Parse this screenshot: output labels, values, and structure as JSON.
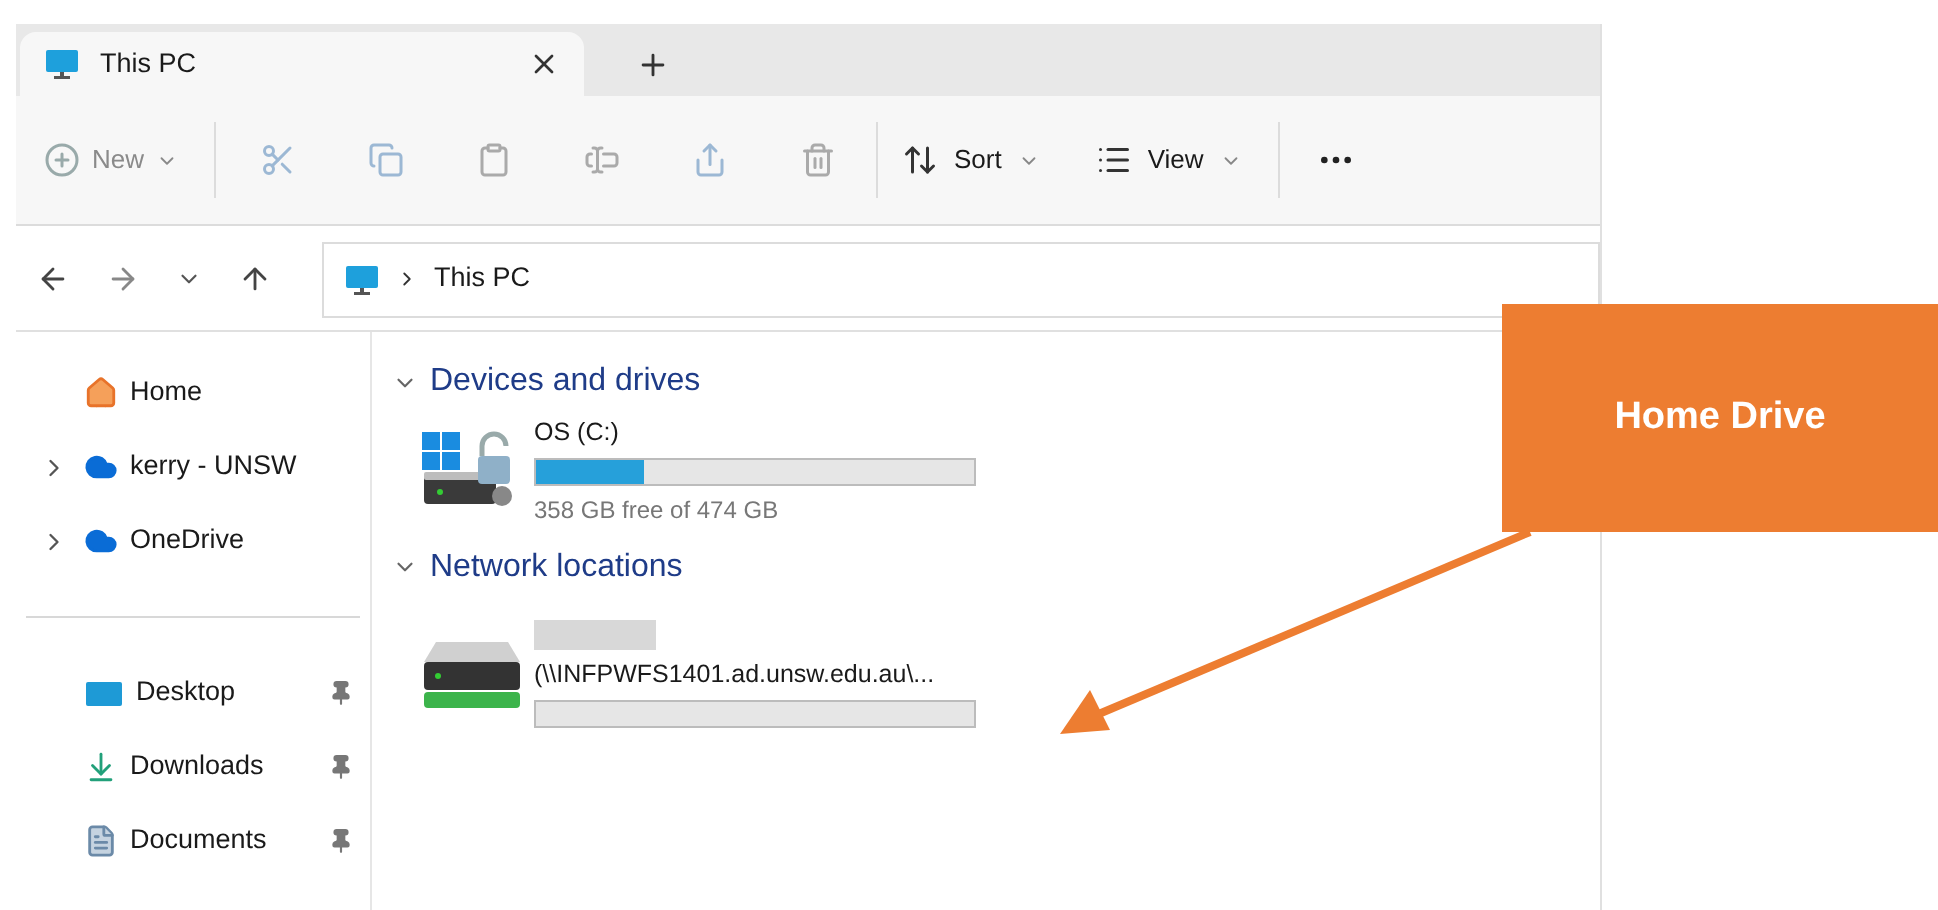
{
  "tabs": [
    {
      "label": "This PC",
      "selected": true
    }
  ],
  "toolbar": {
    "new": {
      "label": "New",
      "disabled": true
    },
    "sort": {
      "label": "Sort"
    },
    "view": {
      "label": "View"
    }
  },
  "address": {
    "path": "This PC"
  },
  "sidebar": {
    "items": [
      {
        "label": "Home",
        "kind": "home",
        "pinned": false
      },
      {
        "label": "kerry - UNSW",
        "kind": "cloud",
        "expanded": false,
        "pinned": false
      },
      {
        "label": "OneDrive",
        "kind": "cloud",
        "expanded": false,
        "pinned": false
      }
    ],
    "quick_access": [
      {
        "label": "Desktop",
        "kind": "desktop",
        "pinned": true
      },
      {
        "label": "Downloads",
        "kind": "download",
        "pinned": true
      },
      {
        "label": "Documents",
        "kind": "document",
        "pinned": true
      }
    ]
  },
  "sections": [
    {
      "title": "Devices and drives",
      "expanded": true,
      "drives": [
        {
          "kind": "local",
          "name": "OS (C:)",
          "level": 0.245,
          "caption": "358 GB free of 474 GB"
        }
      ]
    },
    {
      "title": "Network locations",
      "expanded": true,
      "drives": [
        {
          "kind": "network",
          "name": "(\\\\INFPWFS1401.ad.unsw.edu.au\\...",
          "redacted": true
        }
      ]
    }
  ],
  "callout": {
    "label": "Home Drive"
  }
}
